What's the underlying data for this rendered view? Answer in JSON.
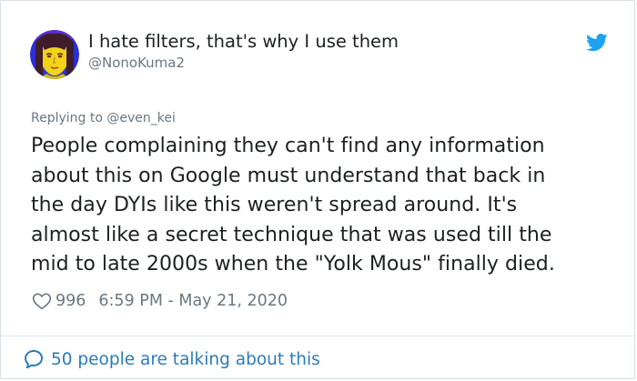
{
  "user": {
    "display_name": "I hate filters, that's why I use them",
    "handle": "@NonoKuma2"
  },
  "reply": {
    "prefix": "Replying to",
    "mention": "@even_kei"
  },
  "tweet": {
    "lines": [
      "People complaining they can't find any information",
      "about this on Google must understand that back in",
      "the day DYIs like this weren't spread around. It's",
      "almost like a secret technique that was used till the",
      "mid to late 2000s when the \"Yolk Mous\" finally died."
    ]
  },
  "meta": {
    "like_count": "996",
    "timestamp": "6:59 PM - May 21, 2020"
  },
  "conversation": {
    "label": "50 people are talking about this"
  },
  "icons": {
    "platform": "twitter-bird-icon",
    "like": "heart-icon",
    "conversation": "speech-bubble-icon"
  },
  "colors": {
    "brand": "#1da1f2",
    "link": "#2b7bb9",
    "muted": "#697882",
    "text": "#1c2022"
  }
}
